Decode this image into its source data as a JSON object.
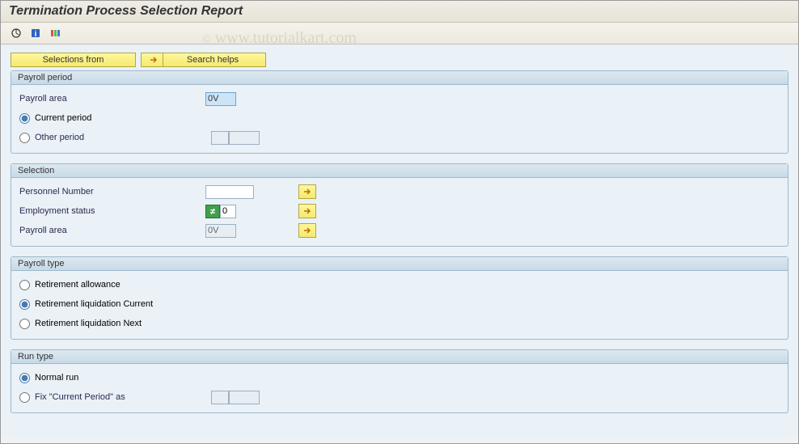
{
  "title": "Termination Process Selection Report",
  "watermark": "www.tutorialkart.com",
  "buttons": {
    "selections_from": "Selections from",
    "search_helps": "Search helps"
  },
  "groups": {
    "payroll_period": {
      "title": "Payroll period",
      "payroll_area_label": "Payroll area",
      "payroll_area_value": "0V",
      "current_period": "Current period",
      "other_period": "Other period"
    },
    "selection": {
      "title": "Selection",
      "personnel_number_label": "Personnel Number",
      "personnel_number_value": "",
      "employment_status_label": "Employment status",
      "employment_status_value": "0",
      "payroll_area_label": "Payroll area",
      "payroll_area_value": "0V"
    },
    "payroll_type": {
      "title": "Payroll type",
      "options": {
        "retirement_allowance": "Retirement allowance",
        "retirement_liq_current": "Retirement liquidation Current",
        "retirement_liq_next": "Retirement liquidation Next"
      }
    },
    "run_type": {
      "title": "Run type",
      "normal_run": "Normal run",
      "fix_current": "Fix \"Current Period\" as"
    }
  }
}
